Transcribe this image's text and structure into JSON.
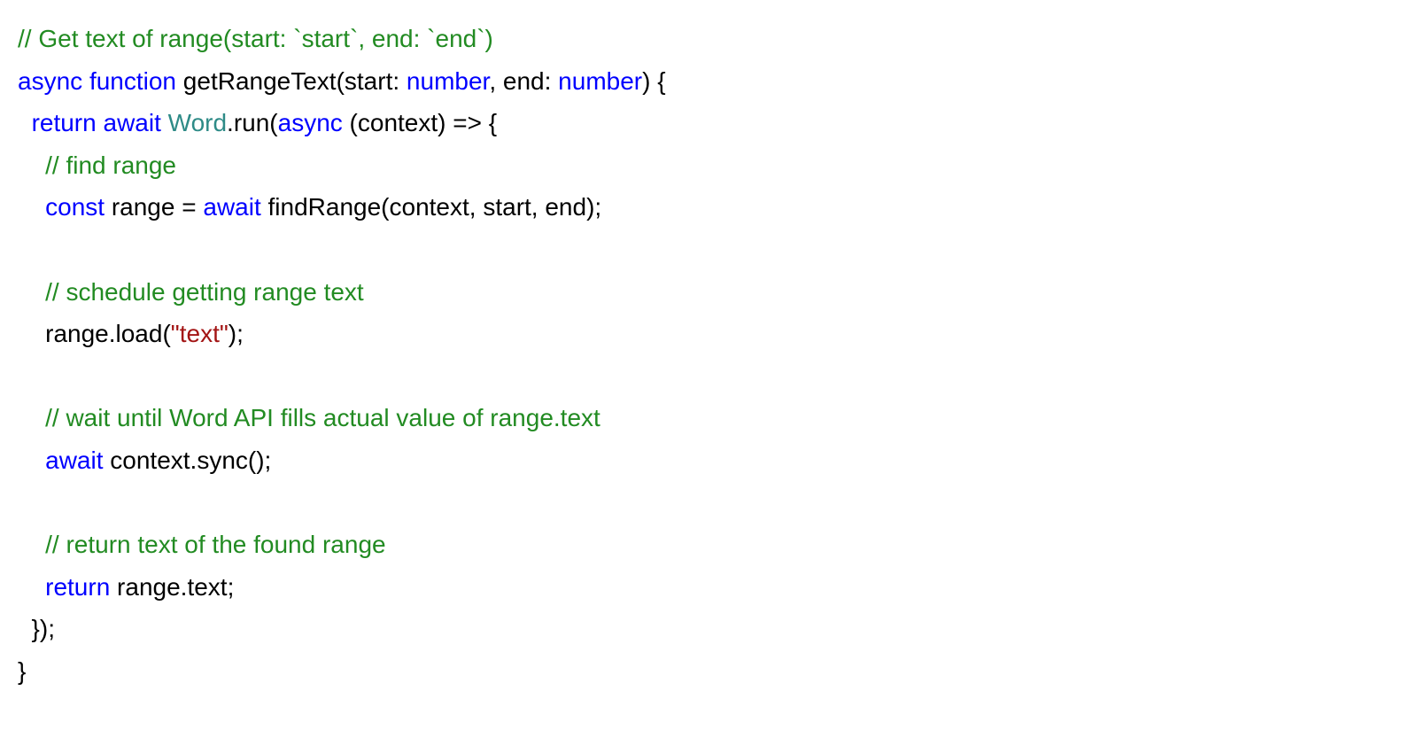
{
  "code": {
    "lines": [
      [
        {
          "cls": "tok-comment",
          "text": "// Get text of range(start: `start`, end: `end`)"
        }
      ],
      [
        {
          "cls": "tok-keyword",
          "text": "async"
        },
        {
          "cls": "tok-default",
          "text": " "
        },
        {
          "cls": "tok-keyword",
          "text": "function"
        },
        {
          "cls": "tok-default",
          "text": " getRangeText(start: "
        },
        {
          "cls": "tok-keyword",
          "text": "number"
        },
        {
          "cls": "tok-default",
          "text": ", end: "
        },
        {
          "cls": "tok-keyword",
          "text": "number"
        },
        {
          "cls": "tok-default",
          "text": ") {"
        }
      ],
      [
        {
          "cls": "tok-default",
          "text": "  "
        },
        {
          "cls": "tok-keyword",
          "text": "return"
        },
        {
          "cls": "tok-default",
          "text": " "
        },
        {
          "cls": "tok-keyword",
          "text": "await"
        },
        {
          "cls": "tok-default",
          "text": " "
        },
        {
          "cls": "tok-classname",
          "text": "Word"
        },
        {
          "cls": "tok-default",
          "text": ".run("
        },
        {
          "cls": "tok-keyword",
          "text": "async"
        },
        {
          "cls": "tok-default",
          "text": " (context) => {"
        }
      ],
      [
        {
          "cls": "tok-default",
          "text": "    "
        },
        {
          "cls": "tok-comment",
          "text": "// find range"
        }
      ],
      [
        {
          "cls": "tok-default",
          "text": "    "
        },
        {
          "cls": "tok-keyword",
          "text": "const"
        },
        {
          "cls": "tok-default",
          "text": " range = "
        },
        {
          "cls": "tok-keyword",
          "text": "await"
        },
        {
          "cls": "tok-default",
          "text": " findRange(context, start, end);"
        }
      ],
      [
        {
          "cls": "tok-default",
          "text": ""
        }
      ],
      [
        {
          "cls": "tok-default",
          "text": "    "
        },
        {
          "cls": "tok-comment",
          "text": "// schedule getting range text"
        }
      ],
      [
        {
          "cls": "tok-default",
          "text": "    range.load("
        },
        {
          "cls": "tok-string",
          "text": "\"text\""
        },
        {
          "cls": "tok-default",
          "text": ");"
        }
      ],
      [
        {
          "cls": "tok-default",
          "text": ""
        }
      ],
      [
        {
          "cls": "tok-default",
          "text": "    "
        },
        {
          "cls": "tok-comment",
          "text": "// wait until Word API fills actual value of range.text"
        }
      ],
      [
        {
          "cls": "tok-default",
          "text": "    "
        },
        {
          "cls": "tok-keyword",
          "text": "await"
        },
        {
          "cls": "tok-default",
          "text": " context.sync();"
        }
      ],
      [
        {
          "cls": "tok-default",
          "text": ""
        }
      ],
      [
        {
          "cls": "tok-default",
          "text": "    "
        },
        {
          "cls": "tok-comment",
          "text": "// return text of the found range"
        }
      ],
      [
        {
          "cls": "tok-default",
          "text": "    "
        },
        {
          "cls": "tok-keyword",
          "text": "return"
        },
        {
          "cls": "tok-default",
          "text": " range.text;"
        }
      ],
      [
        {
          "cls": "tok-default",
          "text": "  });"
        }
      ],
      [
        {
          "cls": "tok-default",
          "text": "}"
        }
      ]
    ]
  }
}
